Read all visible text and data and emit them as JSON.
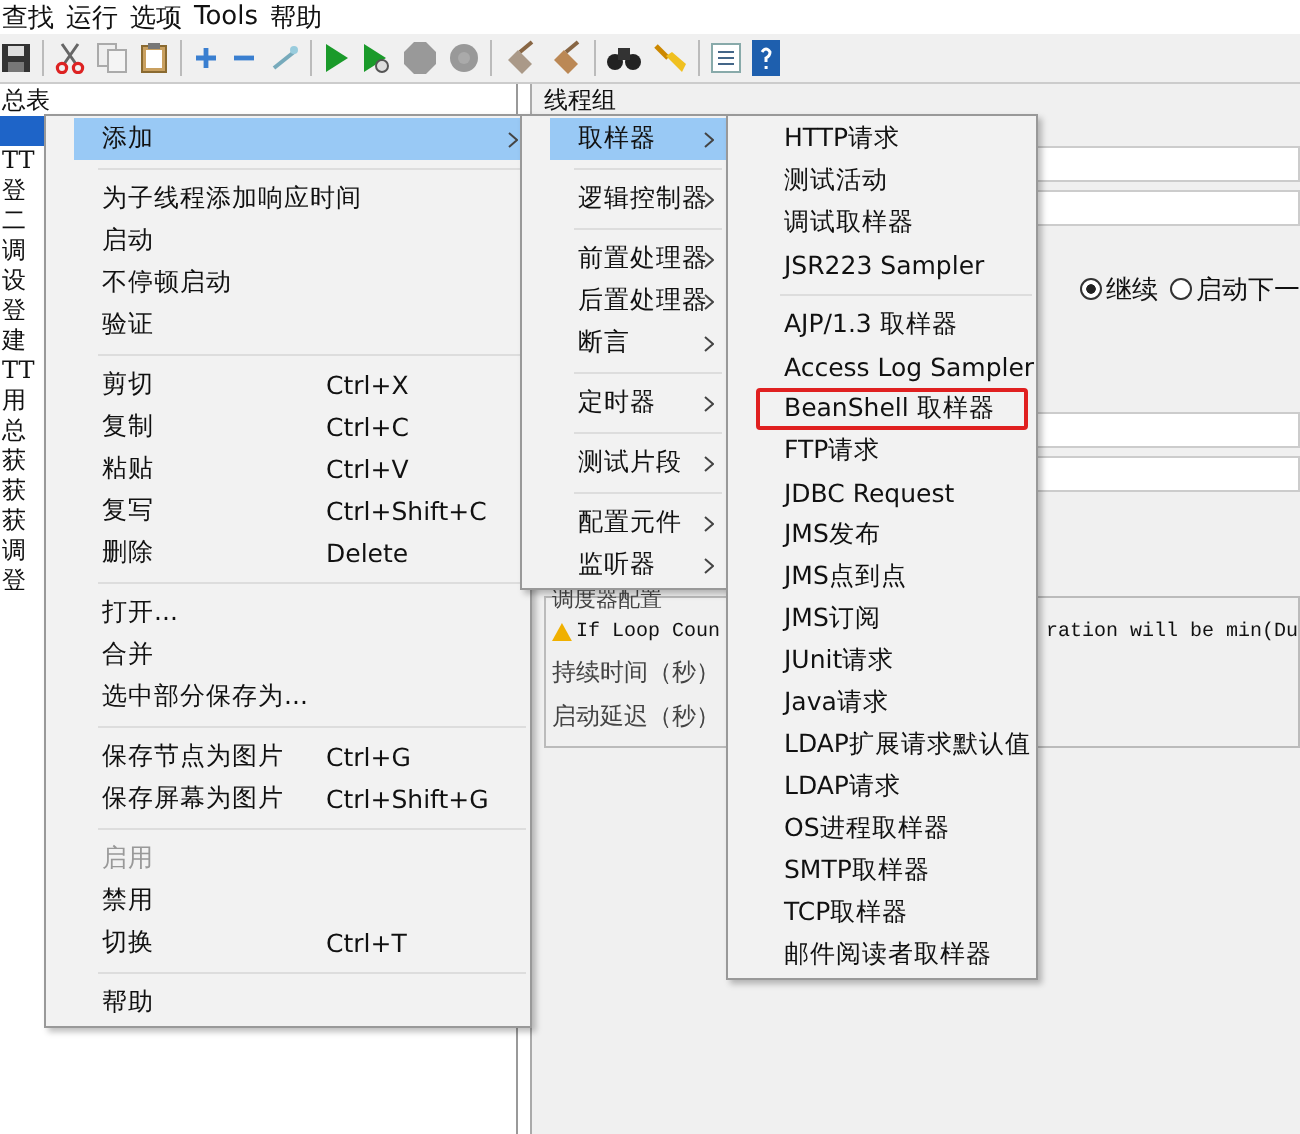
{
  "menu_bar": [
    "查找",
    "运行",
    "选项",
    "Tools",
    "帮助"
  ],
  "tree": {
    "items": [
      {
        "label": "总表",
        "selected": false
      },
      {
        "selected": true
      },
      {
        "label": "TT",
        "selected": false
      },
      {
        "label": "登",
        "selected": false
      },
      {
        "label": "二",
        "selected": false
      },
      {
        "label": "调",
        "selected": false
      },
      {
        "label": "设",
        "selected": false
      },
      {
        "label": "登",
        "selected": false
      },
      {
        "label": "建",
        "selected": false
      },
      {
        "label": "TT",
        "selected": false
      },
      {
        "label": "用",
        "selected": false
      },
      {
        "label": "总",
        "selected": false
      },
      {
        "label": "获",
        "selected": false
      },
      {
        "label": "获",
        "selected": false
      },
      {
        "label": "获",
        "selected": false
      },
      {
        "label": "调",
        "selected": false
      },
      {
        "label": "登",
        "selected": false
      }
    ]
  },
  "panel": {
    "title": "线程组",
    "radios": [
      {
        "label": "继续",
        "selected": true
      },
      {
        "label": "启动下一",
        "selected": false
      }
    ],
    "scheduler": {
      "legend": "调度器配置",
      "warning_left": "If Loop Coun",
      "warning_right": "ration will be min(Du",
      "fields": [
        "持续时间（秒）",
        "启动延迟（秒）"
      ]
    }
  },
  "context_menu": {
    "groups": [
      [
        {
          "label": "添加",
          "selected": true,
          "submenu": true
        }
      ],
      [
        {
          "label": "为子线程添加响应时间",
          "selected": false
        },
        {
          "label": "启动",
          "selected": false
        },
        {
          "label": "不停顿启动",
          "selected": false
        },
        {
          "label": "验证",
          "selected": false
        }
      ],
      [
        {
          "label": "剪切",
          "shortcut": "Ctrl+X",
          "selected": false
        },
        {
          "label": "复制",
          "shortcut": "Ctrl+C",
          "selected": false
        },
        {
          "label": "粘贴",
          "shortcut": "Ctrl+V",
          "selected": false
        },
        {
          "label": "复写",
          "shortcut": "Ctrl+Shift+C",
          "selected": false
        },
        {
          "label": "删除",
          "shortcut": "Delete",
          "selected": false
        }
      ],
      [
        {
          "label": "打开...",
          "selected": false
        },
        {
          "label": "合并",
          "selected": false
        },
        {
          "label": "选中部分保存为...",
          "selected": false
        }
      ],
      [
        {
          "label": "保存节点为图片",
          "shortcut": "Ctrl+G",
          "selected": false
        },
        {
          "label": "保存屏幕为图片",
          "shortcut": "Ctrl+Shift+G",
          "selected": false
        }
      ],
      [
        {
          "label": "启用",
          "disabled": true,
          "selected": false
        },
        {
          "label": "禁用",
          "selected": false
        },
        {
          "label": "切换",
          "shortcut": "Ctrl+T",
          "selected": false
        }
      ],
      [
        {
          "label": "帮助",
          "selected": false
        }
      ]
    ]
  },
  "add_submenu": {
    "groups": [
      [
        {
          "label": "取样器",
          "selected": true,
          "submenu": true
        }
      ],
      [
        {
          "label": "逻辑控制器",
          "selected": false,
          "submenu": true
        }
      ],
      [
        {
          "label": "前置处理器",
          "selected": false,
          "submenu": true
        },
        {
          "label": "后置处理器",
          "selected": false,
          "submenu": true
        },
        {
          "label": "断言",
          "selected": false,
          "submenu": true
        }
      ],
      [
        {
          "label": "定时器",
          "selected": false,
          "submenu": true
        }
      ],
      [
        {
          "label": "测试片段",
          "selected": false,
          "submenu": true
        }
      ],
      [
        {
          "label": "配置元件",
          "selected": false,
          "submenu": true
        },
        {
          "label": "监听器",
          "selected": false,
          "submenu": true
        }
      ]
    ]
  },
  "sampler_submenu": {
    "groups": [
      [
        {
          "label": "HTTP请求",
          "selected": false
        },
        {
          "label": "测试活动",
          "selected": false
        },
        {
          "label": "调试取样器",
          "selected": false
        },
        {
          "label": "JSR223 Sampler",
          "selected": false
        }
      ],
      [
        {
          "label": "AJP/1.3 取样器",
          "selected": false
        },
        {
          "label": "Access Log Sampler",
          "selected": false
        },
        {
          "label": "BeanShell 取样器",
          "selected": false,
          "marked": true
        },
        {
          "label": "FTP请求",
          "selected": false
        },
        {
          "label": "JDBC Request",
          "selected": false
        },
        {
          "label": "JMS发布",
          "selected": false
        },
        {
          "label": "JMS点到点",
          "selected": false
        },
        {
          "label": "JMS订阅",
          "selected": false
        },
        {
          "label": "JUnit请求",
          "selected": false
        },
        {
          "label": "Java请求",
          "selected": false
        },
        {
          "label": "LDAP扩展请求默认值",
          "selected": false
        },
        {
          "label": "LDAP请求",
          "selected": false
        },
        {
          "label": "OS进程取样器",
          "selected": false
        },
        {
          "label": "SMTP取样器",
          "selected": false
        },
        {
          "label": "TCP取样器",
          "selected": false
        },
        {
          "label": "邮件阅读者取样器",
          "selected": false
        }
      ]
    ]
  }
}
